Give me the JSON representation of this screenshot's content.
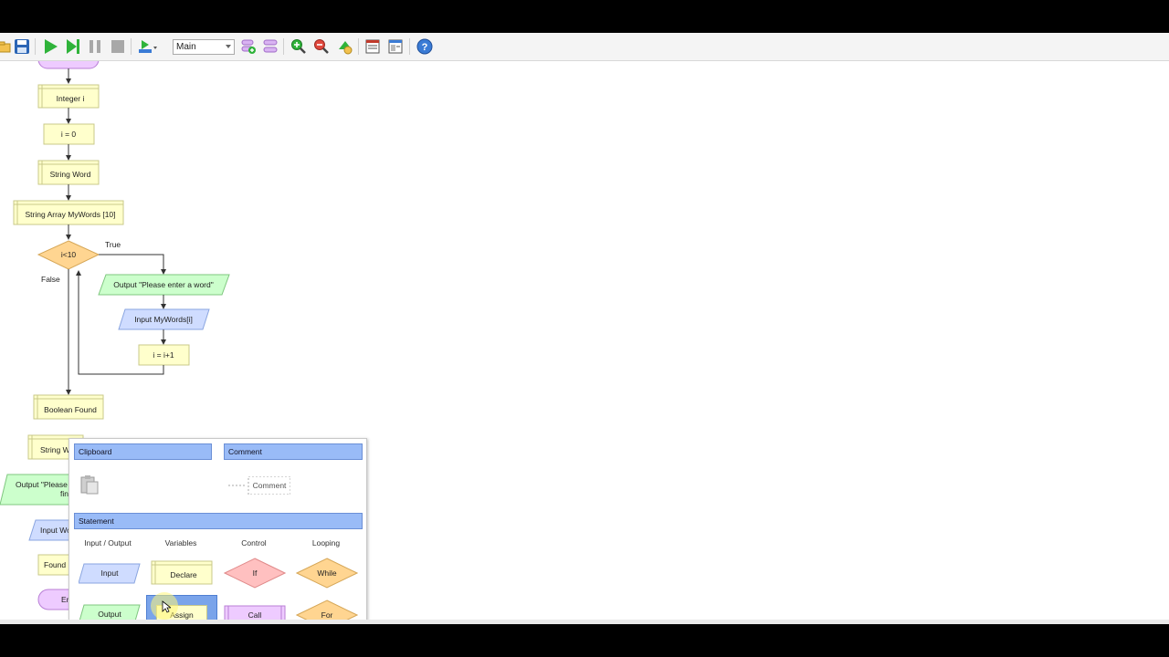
{
  "toolbar": {
    "function_select": "Main",
    "buttons": [
      "open-icon",
      "save-icon",
      "run-icon",
      "step-icon",
      "pause-icon",
      "stop-icon",
      "speed-icon",
      "add-function-icon",
      "delete-function-icon",
      "zoom-in-icon",
      "zoom-out-icon",
      "layout-icon",
      "view-icon",
      "console-icon",
      "help-icon"
    ]
  },
  "flowchart": {
    "nodes": {
      "integer_i": "Integer i",
      "i_assign": "i = 0",
      "string_word": "String Word",
      "string_array": "String Array MyWords [10]",
      "loop_cond": "i<10",
      "output_prompt": "Output \"Please enter a word\"",
      "input_words": "Input MyWords[i]",
      "increment": "i = i+1",
      "boolean_found": "Boolean Found",
      "string_w": "String W",
      "output_please_1": "Output \"Please",
      "output_please_2": "fin",
      "input_w": "Input Wo",
      "found": "Found",
      "end": "En"
    },
    "edge_true": "True",
    "edge_false": "False"
  },
  "palette": {
    "clipboard_header": "Clipboard",
    "comment_header": "Comment",
    "comment_item": "Comment",
    "statement_header": "Statement",
    "columns": [
      "Input / Output",
      "Variables",
      "Control",
      "Looping"
    ],
    "items": {
      "input": "Input",
      "declare": "Declare",
      "if": "If",
      "while": "While",
      "output": "Output",
      "assign": "Assign",
      "call": "Call",
      "for": "For"
    }
  },
  "colors": {
    "declare_fill": "#ffffcc",
    "decision_fill": "#ffd591",
    "output_fill": "#ccffcc",
    "input_fill": "#cfdcff",
    "call_fill": "#eecbff",
    "if_fill": "#ffc0c0",
    "header_fill": "#99bbf7",
    "selection": "#7aa4ea"
  }
}
